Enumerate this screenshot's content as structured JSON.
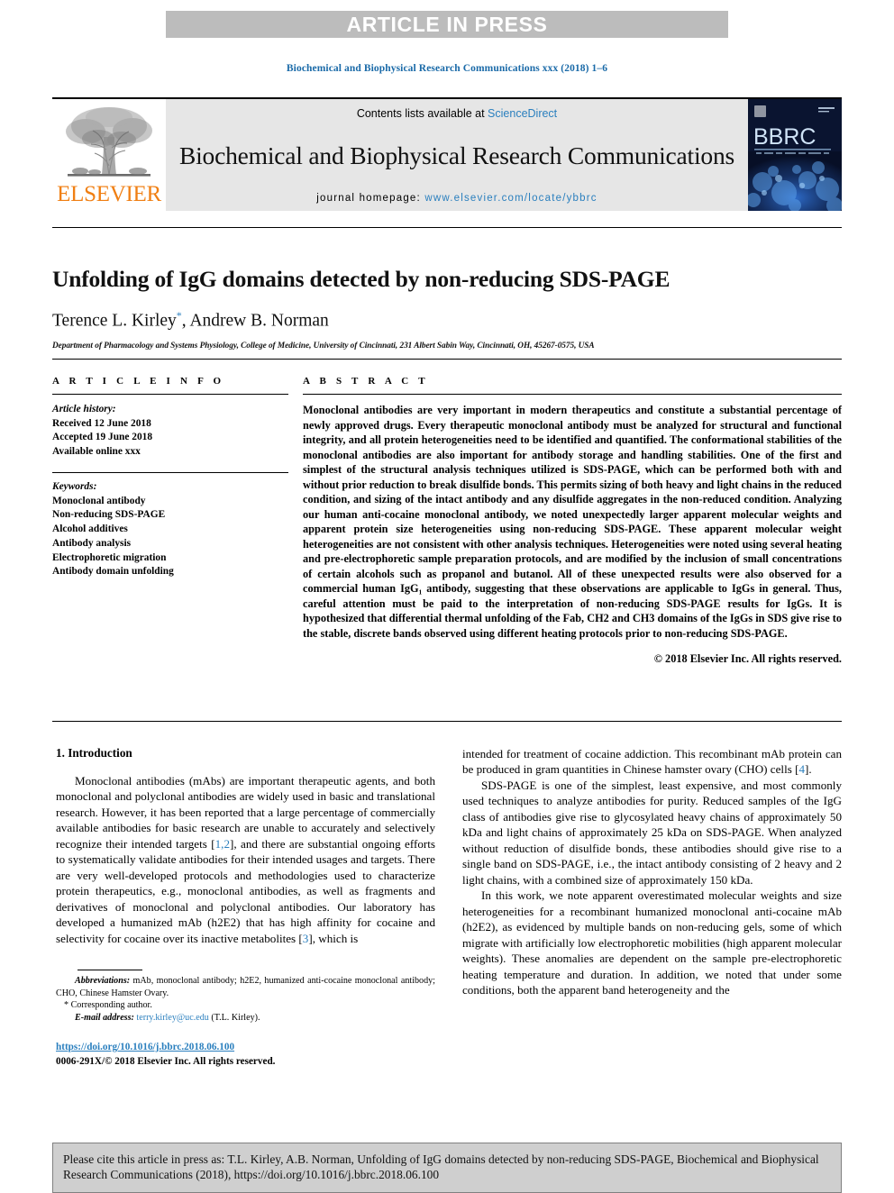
{
  "banner": {
    "label": "ARTICLE IN PRESS"
  },
  "running_head": "Biochemical and Biophysical Research Communications xxx (2018) 1–6",
  "masthead": {
    "publisher_logo_text": "ELSEVIER",
    "contents_prefix": "Contents lists available at ",
    "contents_link": "ScienceDirect",
    "journal_title": "Biochemical and Biophysical Research Communications",
    "homepage_prefix": "journal homepage: ",
    "homepage_url": "www.elsevier.com/locate/ybbrc",
    "cover_title": "BBRC",
    "cover_subtitle": "BIOCHEMICAL AND BIOPHYSICAL RESEARCH COMMUNICATIONS"
  },
  "article": {
    "title": "Unfolding of IgG domains detected by non-reducing SDS-PAGE",
    "authors": "Terence L. Kirley",
    "author_mark": "*",
    "authors_rest": ", Andrew B. Norman",
    "affiliation": "Department of Pharmacology and Systems Physiology, College of Medicine, University of Cincinnati, 231 Albert Sabin Way, Cincinnati, OH, 45267-0575, USA"
  },
  "info": {
    "heading": "A R T I C L E   I N F O",
    "history_label": "Article history:",
    "history": [
      "Received 12 June 2018",
      "Accepted 19 June 2018",
      "Available online xxx"
    ],
    "keywords_label": "Keywords:",
    "keywords": [
      "Monoclonal antibody",
      "Non-reducing SDS-PAGE",
      "Alcohol additives",
      "Antibody analysis",
      "Electrophoretic migration",
      "Antibody domain unfolding"
    ]
  },
  "abstract": {
    "heading": "A B S T R A C T",
    "text": "Monoclonal antibodies are very important in modern therapeutics and constitute a substantial percentage of newly approved drugs. Every therapeutic monoclonal antibody must be analyzed for structural and functional integrity, and all protein heterogeneities need to be identified and quantified. The conformational stabilities of the monoclonal antibodies are also important for antibody storage and handling stabilities. One of the first and simplest of the structural analysis techniques utilized is SDS-PAGE, which can be performed both with and without prior reduction to break disulfide bonds. This permits sizing of both heavy and light chains in the reduced condition, and sizing of the intact antibody and any disulfide aggregates in the non-reduced condition. Analyzing our human anti-cocaine monoclonal antibody, we noted unexpectedly larger apparent molecular weights and apparent protein size heterogeneities using non-reducing SDS-PAGE. These apparent molecular weight heterogeneities are not consistent with other analysis techniques. Heterogeneities were noted using several heating and pre-electrophoretic sample preparation protocols, and are modified by the inclusion of small concentrations of certain alcohols such as propanol and butanol. All of these unexpected results were also observed for a commercial human IgG₁ antibody, suggesting that these observations are applicable to IgGs in general. Thus, careful attention must be paid to the interpretation of non-reducing SDS-PAGE results for IgGs. It is hypothesized that differential thermal unfolding of the Fab, CH2 and CH3 domains of the IgGs in SDS give rise to the stable, discrete bands observed using different heating protocols prior to non-reducing SDS-PAGE.",
    "copyright": "© 2018 Elsevier Inc. All rights reserved."
  },
  "intro": {
    "heading": "1. Introduction",
    "left_para_1_a": "Monoclonal antibodies (mAbs) are important therapeutic agents, and both monoclonal and polyclonal antibodies are widely used in basic and translational research. However, it has been reported that a large percentage of commercially available antibodies for basic research are unable to accurately and selectively recognize their intended targets [",
    "left_ref_1": "1,2",
    "left_para_1_b": "], and there are substantial ongoing efforts to systematically validate antibodies for their intended usages and targets. There are very well-developed protocols and methodologies used to characterize protein therapeutics, e.g., monoclonal antibodies, as well as fragments and derivatives of monoclonal and polyclonal antibodies. Our laboratory has developed a humanized mAb (h2E2) that has high affinity for cocaine and selectivity for cocaine over its inactive metabolites [",
    "left_ref_2": "3",
    "left_para_1_c": "], which is",
    "right_para_1_a": "intended for treatment of cocaine addiction. This recombinant mAb protein can be produced in gram quantities in Chinese hamster ovary (CHO) cells [",
    "right_ref_1": "4",
    "right_para_1_b": "].",
    "right_para_2": "SDS-PAGE is one of the simplest, least expensive, and most commonly used techniques to analyze antibodies for purity. Reduced samples of the IgG class of antibodies give rise to glycosylated heavy chains of approximately 50 kDa and light chains of approximately 25 kDa on SDS-PAGE. When analyzed without reduction of disulfide bonds, these antibodies should give rise to a single band on SDS-PAGE, i.e., the intact antibody consisting of 2 heavy and 2 light chains, with a combined size of approximately 150 kDa.",
    "right_para_3": "In this work, we note apparent overestimated molecular weights and size heterogeneities for a recombinant humanized monoclonal anti-cocaine mAb (h2E2), as evidenced by multiple bands on non-reducing gels, some of which migrate with artificially low electrophoretic mobilities (high apparent molecular weights). These anomalies are dependent on the sample pre-electrophoretic heating temperature and duration. In addition, we noted that under some conditions, both the apparent band heterogeneity and the"
  },
  "footnotes": {
    "abbrev_label": "Abbreviations:",
    "abbrev_text": " mAb, monoclonal antibody; h2E2, humanized anti-cocaine monoclonal antibody; CHO, Chinese Hamster Ovary.",
    "corresponding_mark": "*",
    "corresponding_text": " Corresponding author.",
    "email_label": "E-mail address:",
    "email": "terry.kirley@uc.edu",
    "email_suffix": " (T.L. Kirley).",
    "doi": "https://doi.org/10.1016/j.bbrc.2018.06.100",
    "issn_line": "0006-291X/© 2018 Elsevier Inc. All rights reserved."
  },
  "cite_box": {
    "text": "Please cite this article in press as: T.L. Kirley, A.B. Norman, Unfolding of IgG domains detected by non-reducing SDS-PAGE, Biochemical and Biophysical Research Communications (2018), https://doi.org/10.1016/j.bbrc.2018.06.100"
  },
  "colors": {
    "banner_gray": "#bcbcbc",
    "link_blue": "#2a7fbe",
    "elsevier_orange": "#f07f13",
    "band_gray": "#e6e6e6",
    "cite_gray": "#cfcfcf"
  }
}
